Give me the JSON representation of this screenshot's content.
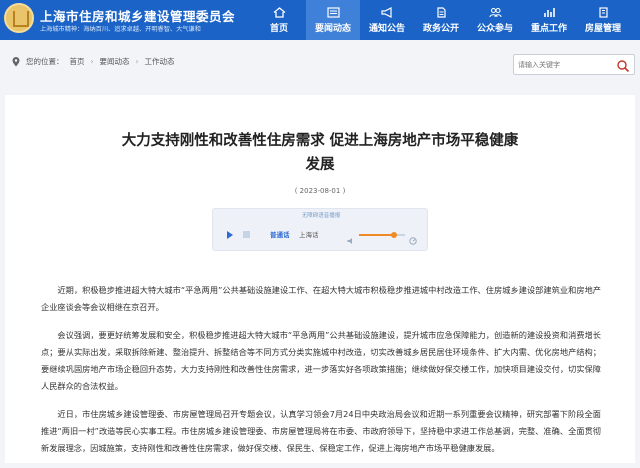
{
  "header": {
    "title": "上海市住房和城乡建设管理委员会",
    "motto": "上海城市精神：海纳百川、追求卓越、开明睿智、大气谦和",
    "colors": {
      "primary": "#1b63c6",
      "active": "#3f80d9"
    }
  },
  "nav": {
    "items": [
      {
        "label": "首页",
        "icon": "home-icon"
      },
      {
        "label": "要闻动态",
        "icon": "news-icon"
      },
      {
        "label": "通知公告",
        "icon": "megaphone-icon"
      },
      {
        "label": "政务公开",
        "icon": "document-icon"
      },
      {
        "label": "公众参与",
        "icon": "people-icon"
      },
      {
        "label": "重点工作",
        "icon": "chart-icon"
      },
      {
        "label": "房屋管理",
        "icon": "building-icon"
      }
    ],
    "active_index": 1
  },
  "breadcrumb": {
    "prefix": "您的位置：",
    "items": [
      "首页",
      "要闻动态",
      "工作动态"
    ],
    "separator": "›"
  },
  "search": {
    "placeholder": "请输入关键字"
  },
  "article": {
    "title_line1": "大力支持刚性和改善性住房需求 促进上海房地产市场平稳健康",
    "title_line2": "发展",
    "date": "( 2023-08-01 )",
    "player": {
      "top_label": "无障碍语音播报",
      "mode": "普通话",
      "language": "上海话"
    },
    "paragraphs": [
      "近期，积极稳步推进超大特大城市“平急两用”公共基础设施建设工作、在超大特大城市积极稳步推进城中村改造工作、住房城乡建设部建筑业和房地产企业座谈会等会议相继在京召开。",
      "会议强调，要更好统筹发展和安全，积极稳步推进超大特大城市“平急两用”公共基础设施建设，提升城市应急保障能力，创造新的建设投资和消费增长点；要从实际出发，采取拆除新建、整治提升、拆整结合等不同方式分类实施城中村改造，切实改善城乡居民居住环境条件、扩大内需、优化房地产结构；要继续巩固房地产市场企稳回升态势，大力支持刚性和改善性住房需求，进一步落实好各项政策措施；继续做好保交楼工作，加快项目建设交付，切实保障人民群众的合法权益。",
      "近日，市住房城乡建设管理委、市房屋管理局召开专题会议，认真学习领会7月24日中央政治局会议和近期一系列重要会议精神，研究部署下阶段全面推进“两旧一村”改造等民心实事工程。市住房城乡建设管理委、市房屋管理局将在市委、市政府领导下，坚持稳中求进工作总基调，完整、准确、全面贯彻新发展理念，因城施策，支持刚性和改善性住房需求，做好保交楼、保民生、保稳定工作，促进上海房地产市场平稳健康发展。"
    ]
  }
}
